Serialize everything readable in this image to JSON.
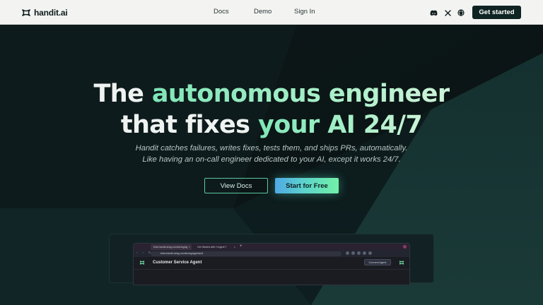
{
  "nav": {
    "logo_text": "handit.ai",
    "links": [
      {
        "label": "Docs"
      },
      {
        "label": "Demo"
      },
      {
        "label": "Sign In"
      }
    ],
    "icons": [
      "discord-icon",
      "x-icon",
      "github-icon"
    ],
    "cta_label": "Get started"
  },
  "hero": {
    "headline_line1_white": "The ",
    "headline_line1_grad": "autonomous engineer",
    "headline_line2_white": "that fixes ",
    "headline_line2_grad": "your AI 24/7",
    "subtitle_line1": "Handit catches failures, writes fixes, tests them, and ships PRs, automatically.",
    "subtitle_line2": "Like having an on-call engineer dedicated to your AI, except it works 24/7.",
    "btn_docs": "View Docs",
    "btn_start": "Start for Free"
  },
  "preview": {
    "tab1": "beta.handit.ai/ag-monitoring/ag",
    "tab2": "Get Started with H Agent T",
    "url": "beta.handit.ai/ag-monitoring/agents/dl",
    "agent_title": "Customer Service Agent",
    "connect_label": "Connect Agent"
  },
  "colors": {
    "nav_bg": "#f3f4f2",
    "hero_bg": "#0c1a1b",
    "accent": "#7fe6b8",
    "cta_dark": "#0f2323"
  }
}
